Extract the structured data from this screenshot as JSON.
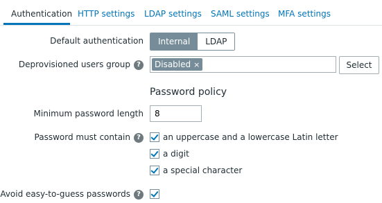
{
  "tabs": [
    {
      "label": "Authentication",
      "active": true
    },
    {
      "label": "HTTP settings",
      "active": false
    },
    {
      "label": "LDAP settings",
      "active": false
    },
    {
      "label": "SAML settings",
      "active": false
    },
    {
      "label": "MFA settings",
      "active": false
    }
  ],
  "form": {
    "default_auth": {
      "label": "Default authentication",
      "options": [
        "Internal",
        "LDAP"
      ],
      "selected": "Internal"
    },
    "deprovisioned": {
      "label": "Deprovisioned users group",
      "help": "?",
      "chip": "Disabled",
      "chip_remove": "×",
      "select_button": "Select"
    },
    "password_policy": {
      "title": "Password policy",
      "min_length": {
        "label": "Minimum password length",
        "value": "8"
      },
      "must_contain": {
        "label": "Password must contain",
        "help": "?",
        "options": [
          {
            "label": "an uppercase and a lowercase Latin letter",
            "checked": true
          },
          {
            "label": "a digit",
            "checked": true
          },
          {
            "label": "a special character",
            "checked": true
          }
        ]
      },
      "avoid_easy": {
        "label": "Avoid easy-to-guess passwords",
        "help": "?",
        "checked": true
      }
    }
  },
  "colors": {
    "link": "#0275b8",
    "segment_active": "#768d99",
    "text": "#1f2c33"
  },
  "icons": {
    "help": "question-circle-icon",
    "checkbox": "checkmark-icon",
    "remove": "close-icon"
  }
}
